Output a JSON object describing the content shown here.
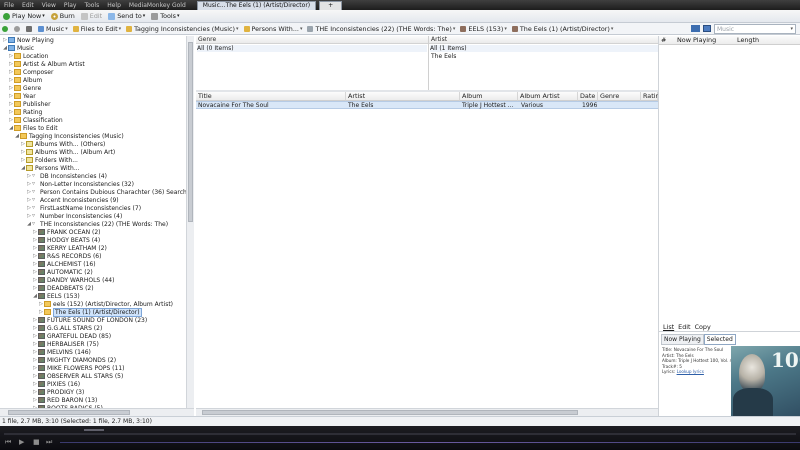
{
  "titlebar": {
    "menu": [
      "File",
      "Edit",
      "View",
      "Play",
      "Tools",
      "Help",
      "MediaMonkey Gold"
    ],
    "tabs": [
      {
        "label": "Music...The Eels (1) (Artist/Director)"
      },
      {
        "label": "+"
      }
    ]
  },
  "toolbar": {
    "play_now": "Play Now",
    "burn": "Burn",
    "edit": "Edit",
    "send_to": "Send to",
    "tools": "Tools"
  },
  "breadcrumb": {
    "items": [
      {
        "label": "Music"
      },
      {
        "label": "Files to Edit"
      },
      {
        "label": "Tagging Inconsistencies (Music)"
      },
      {
        "label": "Persons With..."
      },
      {
        "label": "THE Inconsistencies (22)  (THE Words: The)"
      },
      {
        "label": "EELS (153)"
      },
      {
        "label": "The Eels (1) (Artist/Director)"
      }
    ],
    "search_placeholder": "Music"
  },
  "tree": {
    "nodes": [
      {
        "label": "Now Playing",
        "level": 0,
        "icon": "now-playing-icon"
      },
      {
        "label": "Music",
        "level": 0,
        "icon": "music-folder-icon",
        "expanded": true
      },
      {
        "label": "Location",
        "level": 1,
        "icon": "folder-icon"
      },
      {
        "label": "Artist & Album Artist",
        "level": 1,
        "icon": "folder-icon"
      },
      {
        "label": "Composer",
        "level": 1,
        "icon": "folder-icon"
      },
      {
        "label": "Album",
        "level": 1,
        "icon": "folder-icon"
      },
      {
        "label": "Genre",
        "level": 1,
        "icon": "folder-icon"
      },
      {
        "label": "Year",
        "level": 1,
        "icon": "folder-icon"
      },
      {
        "label": "Publisher",
        "level": 1,
        "icon": "folder-icon"
      },
      {
        "label": "Rating",
        "level": 1,
        "icon": "folder-icon"
      },
      {
        "label": "Classification",
        "level": 1,
        "icon": "folder-icon"
      },
      {
        "label": "Files to Edit",
        "level": 1,
        "icon": "folder-icon",
        "expanded": true
      },
      {
        "label": "Tagging Inconsistencies (Music)",
        "level": 2,
        "icon": "folder-icon",
        "expanded": true
      },
      {
        "label": "Albums With... (Others)",
        "level": 3,
        "icon": "note-icon"
      },
      {
        "label": "Albums With... (Album Art)",
        "level": 3,
        "icon": "note-icon"
      },
      {
        "label": "Folders With...",
        "level": 3,
        "icon": "note-icon"
      },
      {
        "label": "Persons With...",
        "level": 3,
        "icon": "note-icon",
        "expanded": true
      },
      {
        "label": "DB Inconsistencies (4)",
        "level": 4,
        "icon": "filter-icon"
      },
      {
        "label": "Non-Letter Inconsistencies (32)",
        "level": 4,
        "icon": "filter-icon"
      },
      {
        "label": "Person Contains Dubious Charachter (36)  Searches fo",
        "level": 4,
        "icon": "filter-icon"
      },
      {
        "label": "Accent Inconsistencies (9)",
        "level": 4,
        "icon": "filter-icon"
      },
      {
        "label": "FirstLastName Inconsistencies (7)",
        "level": 4,
        "icon": "filter-icon"
      },
      {
        "label": "Number Inconsistencies (4)",
        "level": 4,
        "icon": "filter-icon"
      },
      {
        "label": "THE Inconsistencies (22)  (THE Words: The)",
        "level": 4,
        "icon": "filter-icon",
        "expanded": true
      },
      {
        "label": "FRANK OCEAN (2)",
        "level": 5,
        "icon": "artist-icon"
      },
      {
        "label": "HODGY BEATS (4)",
        "level": 5,
        "icon": "artist-icon"
      },
      {
        "label": "KERRY LEATHAM (2)",
        "level": 5,
        "icon": "artist-icon"
      },
      {
        "label": "R&S RECORDS (6)",
        "level": 5,
        "icon": "artist-icon"
      },
      {
        "label": "ALCHEMIST (16)",
        "level": 5,
        "icon": "artist-icon"
      },
      {
        "label": "AUTOMATIC (2)",
        "level": 5,
        "icon": "artist-icon"
      },
      {
        "label": "DANDY WARHOLS (44)",
        "level": 5,
        "icon": "artist-icon"
      },
      {
        "label": "DEADBEATS (2)",
        "level": 5,
        "icon": "artist-icon"
      },
      {
        "label": "EELS (153)",
        "level": 5,
        "icon": "artist-icon",
        "expanded": true
      },
      {
        "label": "eels (152) (Artist/Director, Album Artist)",
        "level": 6,
        "icon": "artist-folder-icon"
      },
      {
        "label": "The Eels (1) (Artist/Director)",
        "level": 6,
        "icon": "artist-folder-icon",
        "selected": true
      },
      {
        "label": "FUTURE SOUND OF LONDON (23)",
        "level": 5,
        "icon": "artist-icon"
      },
      {
        "label": "G.G.ALL STARS (2)",
        "level": 5,
        "icon": "artist-icon"
      },
      {
        "label": "GRATEFUL DEAD (85)",
        "level": 5,
        "icon": "artist-icon"
      },
      {
        "label": "HERBALISER (75)",
        "level": 5,
        "icon": "artist-icon"
      },
      {
        "label": "MELVINS (146)",
        "level": 5,
        "icon": "artist-icon"
      },
      {
        "label": "MIGHTY DIAMONDS (2)",
        "level": 5,
        "icon": "artist-icon"
      },
      {
        "label": "MIKE FLOWERS POPS (11)",
        "level": 5,
        "icon": "artist-icon"
      },
      {
        "label": "OBSERVER ALL STARS (5)",
        "level": 5,
        "icon": "artist-icon"
      },
      {
        "label": "PIXIES (16)",
        "level": 5,
        "icon": "artist-icon"
      },
      {
        "label": "PRODIGY (3)",
        "level": 5,
        "icon": "artist-icon"
      },
      {
        "label": "RED BARON (13)",
        "level": 5,
        "icon": "artist-icon"
      },
      {
        "label": "ROOTS RADICS (5)",
        "level": 5,
        "icon": "artist-icon"
      }
    ]
  },
  "genre_pane": {
    "header": "Genre",
    "items": [
      "All (0 Items)"
    ]
  },
  "artist_pane": {
    "header": "Artist",
    "items": [
      "All (1 Items)",
      "The Eels"
    ]
  },
  "tracklist": {
    "columns": [
      "Title",
      "Artist",
      "Album",
      "Album Artist",
      "Date",
      "Genre",
      "Ratin"
    ],
    "rows": [
      {
        "title": "Novacaine For The Soul",
        "artist": "The Eels",
        "album": "Triple J Hottest ...",
        "album_artist": "Various",
        "date": "1996",
        "genre": "",
        "rating": ""
      }
    ]
  },
  "now_playing": {
    "columns": [
      "#",
      "Now Playing",
      "Length"
    ],
    "menu": [
      "List",
      "Edit",
      "Copy"
    ],
    "tabs": [
      "Now Playing",
      "Selected"
    ],
    "info": {
      "title": "Title: Novacaine For The Soul",
      "artist": "Artist: The Eels",
      "album": "Album: Triple J Hottest 100, Vol. 4",
      "track": "Track#: 5",
      "lyrics_label": "Lyrics:",
      "lyrics_link": "Lookup lyrics"
    },
    "art_text": "100"
  },
  "status": {
    "text": "1 file, 2.7 MB, 3:10 (Selected: 1 file, 2.7 MB, 3:10)"
  },
  "colors": {
    "accent": "#3a6fb5",
    "player_bg": "#121217",
    "selection": "#cfe3fb"
  }
}
